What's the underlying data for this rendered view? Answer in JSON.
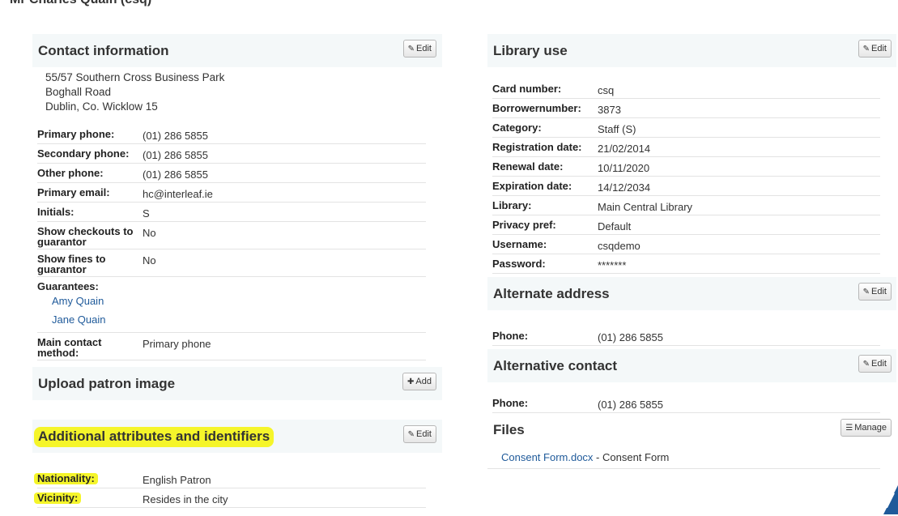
{
  "page": {
    "title": "Mr Charles Quain (csq)"
  },
  "buttons": {
    "edit": "Edit",
    "add": "Add",
    "manage": "Manage"
  },
  "contact": {
    "title": "Contact information",
    "address": [
      "55/57 Southern Cross Business Park",
      "Boghall Road",
      "Dublin, Co. Wicklow 15"
    ],
    "rows": [
      {
        "label": "Primary phone:",
        "value": "(01) 286 5855"
      },
      {
        "label": "Secondary phone:",
        "value": "(01) 286 5855"
      },
      {
        "label": "Other phone:",
        "value": "(01) 286 5855"
      },
      {
        "label": "Primary email:",
        "value": "hc@interleaf.ie"
      },
      {
        "label": "Initials:",
        "value": "S"
      },
      {
        "label": "Show checkouts to guarantor",
        "value": "No"
      },
      {
        "label": "Show fines to guarantor",
        "value": "No"
      }
    ],
    "guarantees_label": "Guarantees:",
    "guarantees": [
      "Amy Quain",
      "Jane Quain"
    ],
    "contact_method_label": "Main contact method:",
    "contact_method_value": "Primary phone"
  },
  "upload": {
    "title": "Upload patron image"
  },
  "attributes": {
    "title": "Additional attributes and identifiers",
    "rows": [
      {
        "label": "Nationality:",
        "value": "English Patron"
      },
      {
        "label": "Vicinity:",
        "value": "Resides in the city"
      }
    ]
  },
  "library_use": {
    "title": "Library use",
    "rows": [
      {
        "label": "Card number:",
        "value": "csq"
      },
      {
        "label": "Borrowernumber:",
        "value": "3873"
      },
      {
        "label": "Category:",
        "value": "Staff (S)"
      },
      {
        "label": "Registration date:",
        "value": "21/02/2014"
      },
      {
        "label": "Renewal date:",
        "value": "10/11/2020"
      },
      {
        "label": "Expiration date:",
        "value": "14/12/2034"
      },
      {
        "label": "Library:",
        "value": "Main Central Library"
      },
      {
        "label": "Privacy pref:",
        "value": "Default"
      },
      {
        "label": "Username:",
        "value": "csqdemo"
      },
      {
        "label": "Password:",
        "value": "*******"
      }
    ]
  },
  "alt_address": {
    "title": "Alternate address",
    "phone_label": "Phone:",
    "phone_value": "(01) 286 5855"
  },
  "alt_contact": {
    "title": "Alternative contact",
    "phone_label": "Phone:",
    "phone_value": "(01) 286 5855"
  },
  "files": {
    "title": "Files",
    "file_name": "Consent Form.docx",
    "file_desc": " - Consent Form"
  },
  "colors": {
    "highlight": "#f5f52a",
    "link": "#1f5a9a",
    "section_bg": "#f4f8f9"
  }
}
